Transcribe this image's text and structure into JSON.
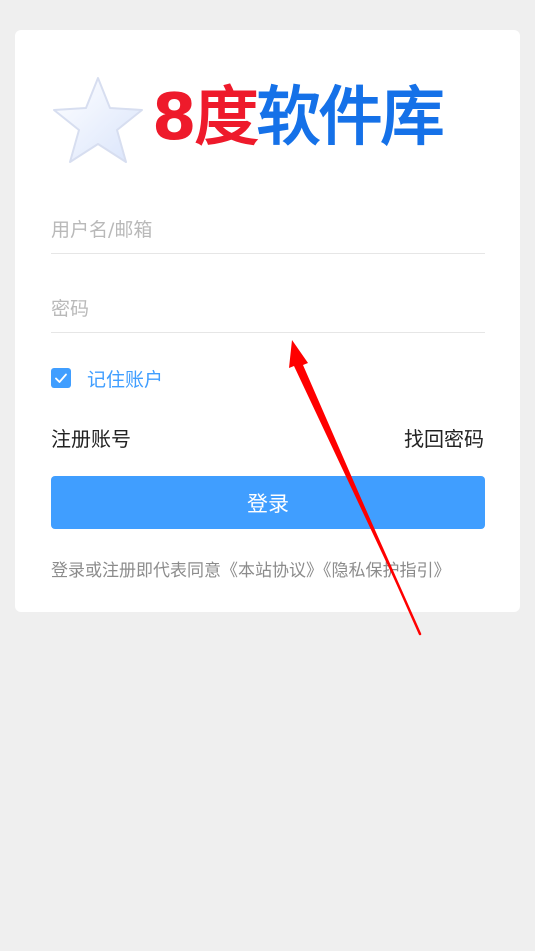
{
  "logo": {
    "text_number": "8",
    "text_red": "度",
    "text_blue": "软件库",
    "icon": "star-icon",
    "colors": {
      "red": "#ee1a2b",
      "blue": "#1571e8"
    }
  },
  "login_form": {
    "username_placeholder": "用户名/邮箱",
    "password_placeholder": "密码",
    "remember_label": "记住账户",
    "remember_checked": true,
    "register_link": "注册账号",
    "forgot_link": "找回密码",
    "login_button": "登录",
    "agreement_prefix": "登录或注册即代表同意",
    "terms_link": "《本站协议》",
    "privacy_link": "《隐私保护指引》"
  },
  "colors": {
    "accent": "#409eff",
    "background": "#efefef",
    "card": "#ffffff",
    "annotation_arrow": "#ff0000"
  }
}
